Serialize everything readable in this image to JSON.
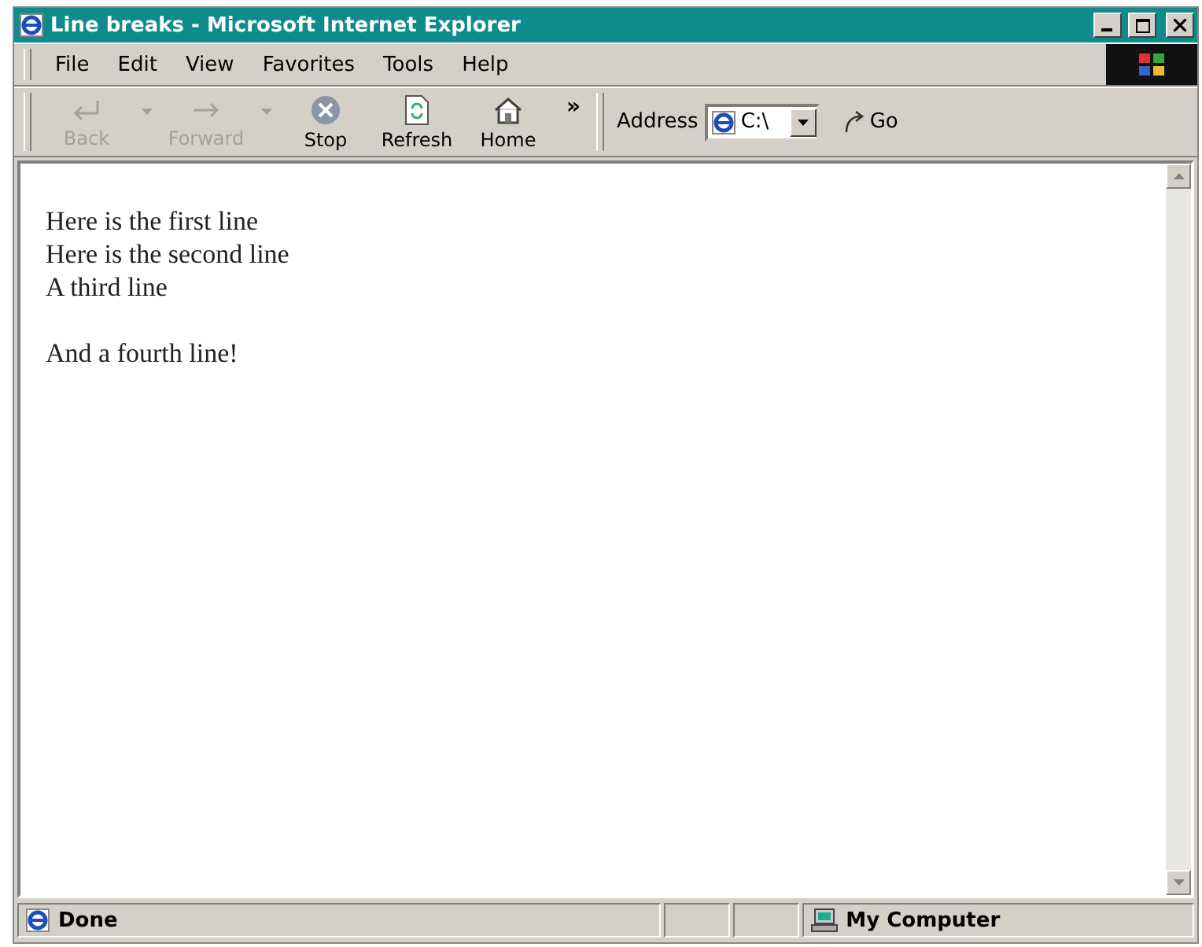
{
  "window": {
    "title": "Line breaks - Microsoft Internet Explorer"
  },
  "menu": [
    "File",
    "Edit",
    "View",
    "Favorites",
    "Tools",
    "Help"
  ],
  "toolbar": [
    {
      "kind": "back",
      "label": "Back",
      "disabled": true,
      "dropdown": true
    },
    {
      "kind": "forward",
      "label": "Forward",
      "disabled": true,
      "dropdown": true
    },
    {
      "kind": "stop",
      "label": "Stop",
      "disabled": false,
      "dropdown": false
    },
    {
      "kind": "refresh",
      "label": "Refresh",
      "disabled": false,
      "dropdown": false
    },
    {
      "kind": "home",
      "label": "Home",
      "disabled": false,
      "dropdown": false
    }
  ],
  "chevron": "»",
  "address": {
    "label": "Address",
    "value": "C:\\"
  },
  "go": "Go",
  "content": {
    "paragraphs": [
      [
        "Here is the first line",
        "Here is the second line",
        "A third line"
      ],
      [
        "And a fourth line!"
      ]
    ]
  },
  "status_bar": {
    "text": "Done",
    "zone": "My Computer"
  }
}
